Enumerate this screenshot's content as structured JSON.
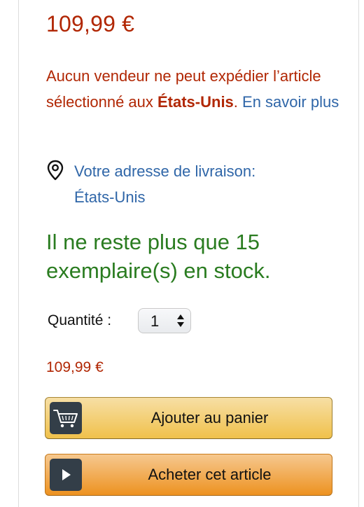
{
  "price_top": "109,99 €",
  "shipping": {
    "part1": "Aucun vendeur ne peut expédier l’article sélectionné aux ",
    "country_bold": "États-Unis",
    "part2": ". ",
    "learn_more": "En savoir plus"
  },
  "address": {
    "icon": "location-pin-icon",
    "link": "Votre adresse de livraison: États-Unis"
  },
  "stock_text": "Il ne reste plus que 15 exemplaire(s) en stock.",
  "quantity": {
    "label": "Quantité :",
    "selected": "1"
  },
  "price_bottom": "109,99 €",
  "buttons": {
    "add_to_cart": {
      "label": "Ajouter au panier",
      "icon": "cart-icon"
    },
    "buy_now": {
      "label": "Acheter cet article",
      "icon": "play-icon"
    }
  },
  "colors": {
    "price": "#B12704",
    "link": "#2f66a8",
    "stock": "#2a7c20",
    "cart_button": "#f0c14b",
    "buy_button": "#ed9220",
    "icon_box": "#333e48"
  }
}
